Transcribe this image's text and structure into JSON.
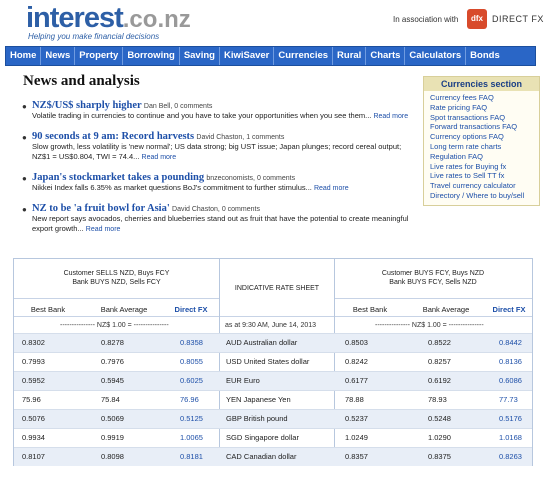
{
  "header": {
    "logo_main": "interest",
    "logo_domain": ".co.nz",
    "tagline": "Helping you make financial decisions",
    "association": "In association with",
    "partner_logo": "dfx",
    "partner_name": "DIRECT FX"
  },
  "nav": {
    "items": [
      "Home",
      "News",
      "Property",
      "Borrowing",
      "Saving",
      "KiwiSaver",
      "Currencies",
      "Rural",
      "Charts",
      "Calculators",
      "Bonds"
    ]
  },
  "news": {
    "title": "News and analysis",
    "readmore_label": "Read more",
    "items": [
      {
        "headline": "NZ$/US$ sharply higher",
        "byline": "Dan Bell, 0 comments",
        "summary": "Volatile trading in currencies to continue and you have to take your opportunities when you see them..."
      },
      {
        "headline": "90 seconds at 9 am: Record harvests",
        "byline": "David Chaston, 1 comments",
        "summary": "Slow growth, less volatility is 'new normal'; US data strong; big UST issue; Japan plunges; record cereal output; NZ$1 = US$0.804, TWI = 74.4..."
      },
      {
        "headline": "Japan's stockmarket takes a pounding",
        "byline": "bnzeconomists, 0 comments",
        "summary": "Nikkei Index falls 6.35% as market questions BoJ's commitment to further stimulus..."
      },
      {
        "headline": "NZ to be 'a fruit bowl for Asia'",
        "byline": "David Chaston, 0 comments",
        "summary": "New report says avocados, cherries and blueberries stand out as fruit that have the potential to create meaningful export growth..."
      }
    ]
  },
  "currencies_section": {
    "title": "Currencies section",
    "links": [
      "Currency fees FAQ",
      "Rate pricing FAQ",
      "Spot transactions FAQ",
      "Forward transactions FAQ",
      "Currency options FAQ",
      "Long term rate charts",
      "Regulation FAQ",
      "Live rates for Buying fx",
      "Live rates to Sell TT fx",
      "Travel currency calculator",
      "Directory / Where to buy/sell"
    ]
  },
  "rate_sheet": {
    "left_header": {
      "line1": "Customer SELLS NZD, Buys FCY",
      "line2": "Bank BUYS NZD, Sells FCY"
    },
    "middle_header": "INDICATIVE RATE SHEET",
    "right_header": {
      "line1": "Customer BUYS FCY, Buys NZD",
      "line2": "Bank BUYS FCY, Sells NZD"
    },
    "columns": {
      "best_bank": "Best Bank",
      "bank_average": "Bank Average",
      "direct_fx": "Direct FX"
    },
    "nz_line": "--------------- NZ$ 1.00 = ---------------",
    "timestamp": "as at 9:30 AM, June 14, 2013",
    "rows": [
      {
        "lb": "0.8302",
        "la": "0.8278",
        "ld": "0.8358",
        "cur": "AUD Australian dollar",
        "rb": "0.8503",
        "ra": "0.8522",
        "rd": "0.8442"
      },
      {
        "lb": "0.7993",
        "la": "0.7976",
        "ld": "0.8055",
        "cur": "USD United States dollar",
        "rb": "0.8242",
        "ra": "0.8257",
        "rd": "0.8136"
      },
      {
        "lb": "0.5952",
        "la": "0.5945",
        "ld": "0.6025",
        "cur": "EUR Euro",
        "rb": "0.6177",
        "ra": "0.6192",
        "rd": "0.6086"
      },
      {
        "lb": "75.96",
        "la": "75.84",
        "ld": "76.96",
        "cur": "YEN Japanese Yen",
        "rb": "78.88",
        "ra": "78.93",
        "rd": "77.73"
      },
      {
        "lb": "0.5076",
        "la": "0.5069",
        "ld": "0.5125",
        "cur": "GBP British pound",
        "rb": "0.5237",
        "ra": "0.5248",
        "rd": "0.5176"
      },
      {
        "lb": "0.9934",
        "la": "0.9919",
        "ld": "1.0065",
        "cur": "SGD Singapore dollar",
        "rb": "1.0249",
        "ra": "1.0290",
        "rd": "1.0168"
      },
      {
        "lb": "0.8107",
        "la": "0.8098",
        "ld": "0.8181",
        "cur": "CAD Canadian dollar",
        "rb": "0.8357",
        "ra": "0.8375",
        "rd": "0.8263"
      }
    ]
  },
  "colors": {
    "brand_blue": "#2d5fa6",
    "nav_blue": "#2a66c6",
    "link_blue": "#1d4fa8",
    "partner_red": "#d84a2b"
  }
}
